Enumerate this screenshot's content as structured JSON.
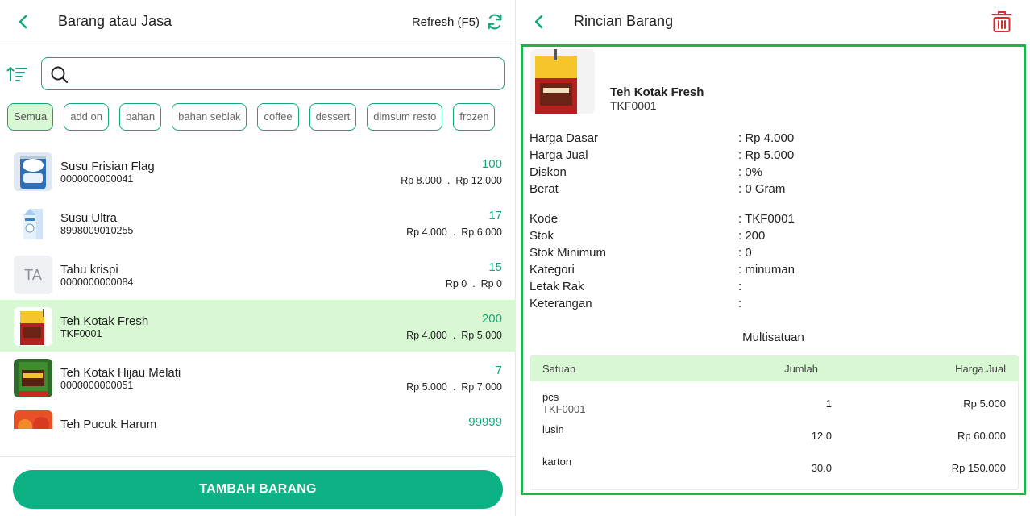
{
  "left_panel": {
    "title": "Barang atau Jasa",
    "refresh_label": "Refresh (F5)",
    "search": {
      "value": "",
      "placeholder": ""
    },
    "categories": [
      "Semua",
      "add on",
      "bahan",
      "bahan seblak",
      "coffee",
      "dessert",
      "dimsum resto",
      "frozen"
    ],
    "active_category": "Semua",
    "items": [
      {
        "name": "Susu Frisian Flag",
        "code": "0000000000041",
        "stock": "100",
        "price_base": "Rp 8.000",
        "price_sell": "Rp 12.000",
        "thumb": "milk-can"
      },
      {
        "name": "Susu Ultra",
        "code": "8998009010255",
        "stock": "17",
        "price_base": "Rp 4.000",
        "price_sell": "Rp 6.000",
        "thumb": "milk-carton"
      },
      {
        "name": "Tahu krispi",
        "code": "0000000000084",
        "stock": "15",
        "price_base": "Rp 0",
        "price_sell": "Rp 0",
        "thumb": "TA"
      },
      {
        "name": "Teh Kotak Fresh",
        "code": "TKF0001",
        "stock": "200",
        "price_base": "Rp 4.000",
        "price_sell": "Rp 5.000",
        "thumb": "tea-box"
      },
      {
        "name": "Teh Kotak Hijau Melati",
        "code": "0000000000051",
        "stock": "7",
        "price_base": "Rp 5.000",
        "price_sell": "Rp 7.000",
        "thumb": "tea-box-dark"
      },
      {
        "name": "Teh Pucuk Harum",
        "code": "",
        "stock": "99999",
        "price_base": "",
        "price_sell": "",
        "thumb": "tea-bottle"
      }
    ],
    "price_separator": ".",
    "add_button": "TAMBAH BARANG"
  },
  "right_panel": {
    "title": "Rincian Barang",
    "item_name": "Teh Kotak Fresh",
    "item_code": "TKF0001",
    "fields_group1": [
      {
        "label": "Harga Dasar",
        "value": ": Rp 4.000"
      },
      {
        "label": "Harga Jual",
        "value": ": Rp 5.000"
      },
      {
        "label": "Diskon",
        "value": ": 0%"
      },
      {
        "label": "Berat",
        "value": ": 0 Gram"
      }
    ],
    "fields_group2": [
      {
        "label": "Kode",
        "value": ": TKF0001"
      },
      {
        "label": "Stok",
        "value": ": 200"
      },
      {
        "label": "Stok Minimum",
        "value": ": 0"
      },
      {
        "label": "Kategori",
        "value": ": minuman"
      },
      {
        "label": "Letak Rak",
        "value": ":"
      },
      {
        "label": "Keterangan",
        "value": ":"
      }
    ],
    "multisatuan_title": "Multisatuan",
    "table": {
      "headers": {
        "unit": "Satuan",
        "qty": "Jumlah",
        "price": "Harga Jual"
      },
      "rows": [
        {
          "unit": "pcs",
          "code": "TKF0001",
          "qty": "1",
          "price": "Rp 5.000"
        },
        {
          "unit": "lusin",
          "code": "",
          "qty": "12.0",
          "price": "Rp 60.000"
        },
        {
          "unit": "karton",
          "code": "",
          "qty": "30.0",
          "price": "Rp 150.000"
        }
      ]
    }
  },
  "colors": {
    "accent": "#12a67a",
    "button": "#0cb283",
    "selected_row": "#d7f8d3",
    "detail_border": "#22b050",
    "trash": "#e0292b"
  }
}
